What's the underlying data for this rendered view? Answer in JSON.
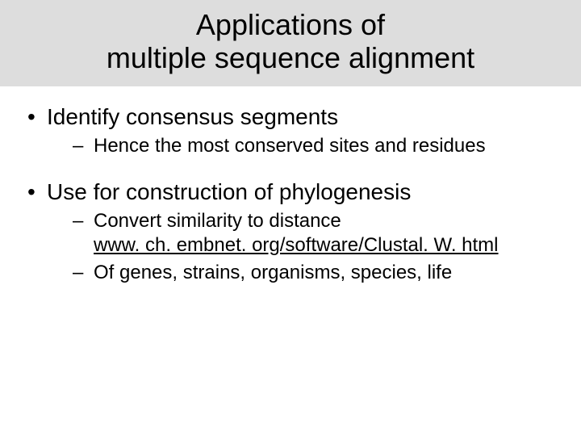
{
  "title_line1": "Applications of",
  "title_line2": "multiple sequence alignment",
  "bullets": [
    {
      "text": "Identify consensus segments",
      "sub": [
        {
          "text": "Hence the most conserved sites and residues"
        }
      ]
    },
    {
      "text": "Use for construction of phylogenesis",
      "sub": [
        {
          "text": "Convert similarity to distance",
          "link": "www. ch. embnet. org/software/Clustal. W. html"
        },
        {
          "text": "Of genes, strains, organisms, species, life"
        }
      ]
    }
  ]
}
